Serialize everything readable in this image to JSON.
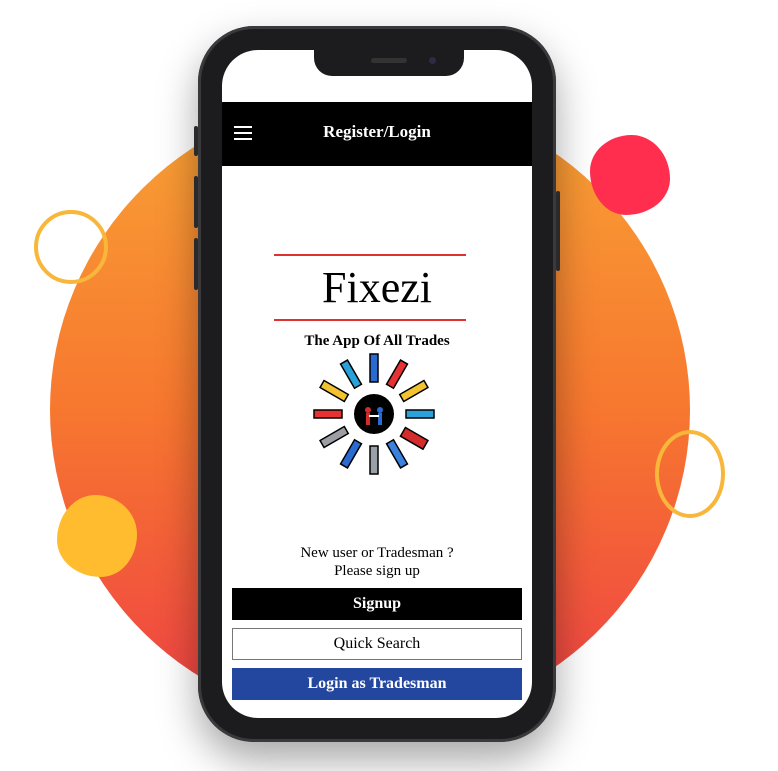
{
  "header": {
    "title": "Register/Login",
    "menu_icon": "hamburger-menu-icon"
  },
  "logo": {
    "title": "Fixezi",
    "tagline": "The App Of All Trades",
    "accent_color": "#e03030"
  },
  "signup_prompt": {
    "line1": "New user or Tradesman ?",
    "line2": "Please sign up"
  },
  "buttons": {
    "signup": "Signup",
    "quick_search": "Quick Search",
    "login_tradesman": "Login as Tradesman"
  },
  "colors": {
    "appbar": "#000000",
    "signup_button": "#000000",
    "login_button": "#23469e",
    "background_gradient_top": "#f8a335",
    "background_gradient_bottom": "#ee3f45"
  }
}
